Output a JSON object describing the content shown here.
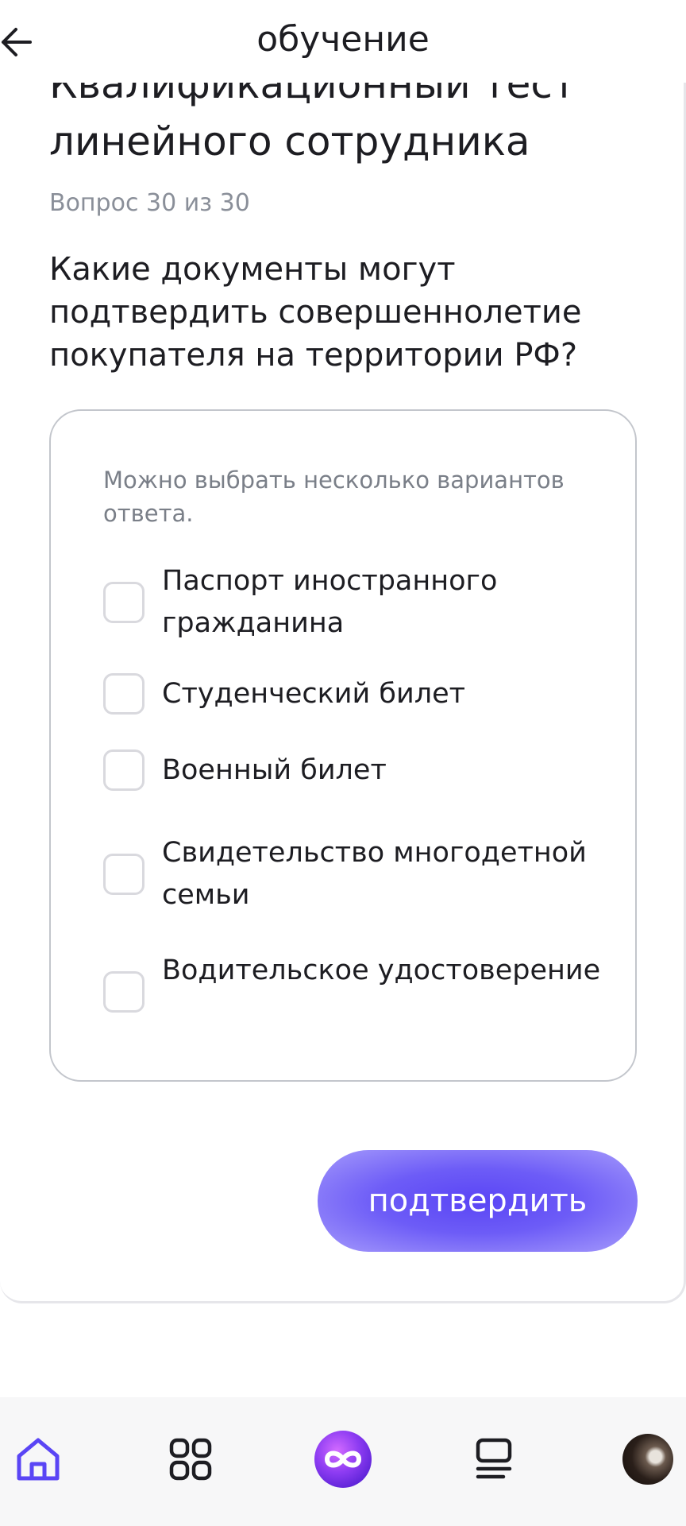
{
  "header": {
    "title": "обучение"
  },
  "test": {
    "title_cut": "Квалификационный тест",
    "title": "линейного сотрудника",
    "counter": "Вопрос 30 из 30",
    "question": "Какие документы могут подтвердить совершеннолетие покупателя на территории РФ?"
  },
  "options_box": {
    "hint": "Можно выбрать несколько вариантов ответа.",
    "options": [
      {
        "label": "Паспорт иностранного гражданина",
        "checked": false
      },
      {
        "label": "Студенческий билет",
        "checked": false
      },
      {
        "label": "Военный билет",
        "checked": false
      },
      {
        "label": "Свидетельство многодетной семьи",
        "checked": false
      },
      {
        "label": "Водительское удостоверение",
        "checked": false
      }
    ]
  },
  "confirm": {
    "label": "подтвердить"
  },
  "nav": {
    "items": [
      {
        "icon": "home-icon"
      },
      {
        "icon": "apps-grid-icon"
      },
      {
        "icon": "infinity-logo-icon"
      },
      {
        "icon": "list-icon"
      },
      {
        "icon": "avatar"
      }
    ]
  },
  "colors": {
    "accent": "#5a45f5",
    "accent_light": "#a59afb",
    "text": "#1d1d22",
    "muted": "#8a8f99",
    "border": "#c3c6cc"
  }
}
